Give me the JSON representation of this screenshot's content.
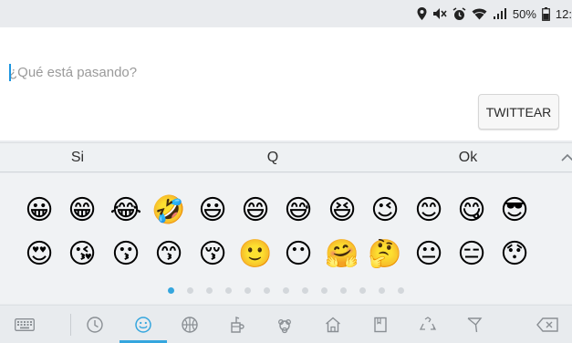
{
  "status_bar": {
    "battery_percent": "50%",
    "time": "12:",
    "icons": [
      "location-icon",
      "mute-icon",
      "alarm-icon",
      "wifi-icon",
      "signal-icon",
      "battery-icon"
    ]
  },
  "compose": {
    "placeholder": "¿Qué está pasando?",
    "value": "",
    "tweet_button_label": "TWITTEAR"
  },
  "suggestions": [
    "Si",
    "Q",
    "Ok"
  ],
  "emoji_rows": [
    [
      "😀",
      "😁",
      "😂",
      "🤣",
      "😃",
      "😄",
      "😅",
      "😆",
      "😉",
      "😊",
      "😋",
      "😎"
    ],
    [
      "😍",
      "😘",
      "😗",
      "😙",
      "😚",
      "🙂",
      "😶",
      "🤗",
      "🤔",
      "😐",
      "😑",
      "😯"
    ]
  ],
  "pager": {
    "pages": 13,
    "current": 1
  },
  "tabs": [
    {
      "name": "keyboard-icon",
      "active": false
    },
    {
      "name": "recent-icon",
      "active": false
    },
    {
      "name": "smileys-icon",
      "active": true
    },
    {
      "name": "activity-icon",
      "active": false
    },
    {
      "name": "food-icon",
      "active": false
    },
    {
      "name": "nature-icon",
      "active": false
    },
    {
      "name": "places-icon",
      "active": false
    },
    {
      "name": "objects-icon",
      "active": false
    },
    {
      "name": "symbols-icon",
      "active": false
    },
    {
      "name": "flags-icon",
      "active": false
    },
    {
      "name": "backspace-icon",
      "active": false
    }
  ],
  "colors": {
    "accent": "#35a6de",
    "emoji_yellow": "#f7c12e",
    "icon_gray": "#8a8f94"
  }
}
